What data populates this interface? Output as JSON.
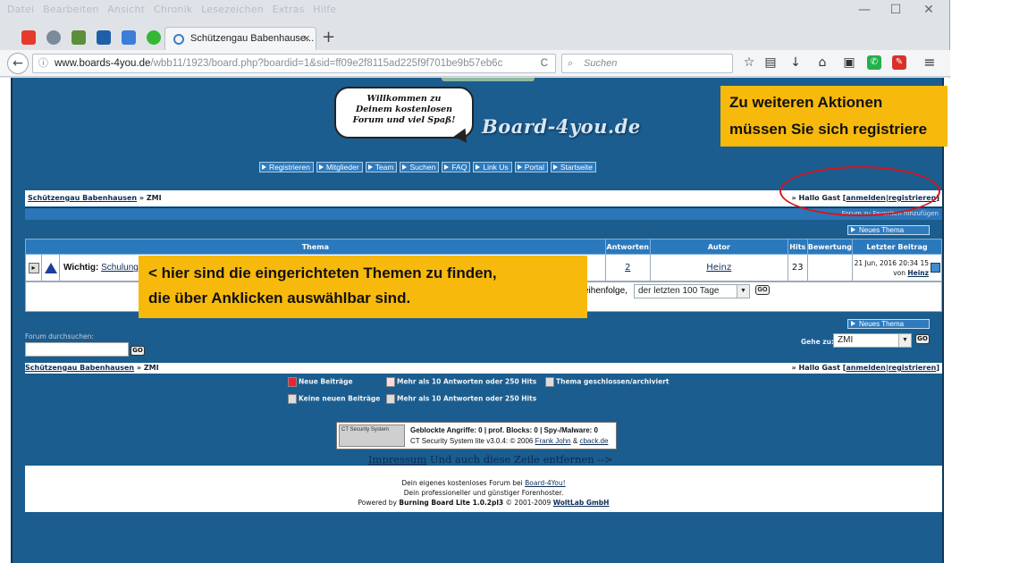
{
  "browser": {
    "menu": [
      "Datei",
      "Bearbeiten",
      "Ansicht",
      "Chronik",
      "Lesezeichen",
      "Extras",
      "Hilfe"
    ],
    "tab_title": "Schützengau Babenhause...",
    "url_host": "www.boards-4you.de",
    "url_path": "/wbb11/1923/board.php?boardid=1&sid=ff09e2f8115ad225f9f701be9b57eb6c",
    "search_placeholder": "Suchen",
    "window_controls": [
      "—",
      "☐",
      "✕"
    ]
  },
  "forum": {
    "bubble_text": [
      "Willkommen zu",
      "Deinem kostenlosen",
      "Forum und viel Spaß!"
    ],
    "logo": "Board-4you.de",
    "nav_buttons": [
      "Registrieren",
      "Mitglieder",
      "Team",
      "Suchen",
      "FAQ",
      "Link Us",
      "Portal",
      "Startseite"
    ],
    "breadcrumb": {
      "board": "Schützengau Babenhausen",
      "sep": " » ",
      "current": "ZMI"
    },
    "greeting": {
      "prefix": "» Hallo Gast [",
      "login": "anmelden",
      "sep": "|",
      "register": "registrieren",
      "suffix": "]"
    },
    "favorites": "Forum zu Favoriten hinzufügen",
    "new_topic": "Neues Thema",
    "table": {
      "headers": [
        "Thema",
        "Antworten",
        "Autor",
        "Hits",
        "Bewertung",
        "Letzter Beitrag"
      ],
      "rows": [
        {
          "prefix": "Wichtig:",
          "title": "Schulung",
          "replies": "2",
          "author": "Heinz",
          "hits": "23",
          "rating": "",
          "last_date": "21 Jun, 2016 20:34 15",
          "last_by_prefix": "von",
          "last_by": "Heinz"
        }
      ]
    },
    "sort": {
      "label": "eihenfolge,",
      "value": "der letzten 100 Tage",
      "go": "GO"
    },
    "search_label": "Forum durchsuchen:",
    "jump_label": "Gehe zu:",
    "jump_value": "ZMI",
    "legend": {
      "new_posts": "Neue Beiträge",
      "hot_new": "Mehr als 10 Antworten oder 250 Hits",
      "closed": "Thema geschlossen/archiviert",
      "no_new": "Keine neuen Beiträge",
      "hot_no_new": "Mehr als 10 Antworten oder 250 Hits"
    },
    "security": {
      "badge": "CT Security System",
      "line1": "Geblockte Angriffe: 0 | prof. Blocks: 0 | Spy-/Malware: 0",
      "line2_prefix": "CT Security System lite v3.0.4: © 2006",
      "author": "Frank John",
      "amp": "&",
      "site": "cback.de"
    },
    "impressum": {
      "link": "Impressum",
      "rest": " Und auch diese Zeile entfernen -->"
    },
    "footer": {
      "line1_prefix": "Dein eigenes kostenloses Forum bei",
      "line1_link": "Board-4You!",
      "line2": "Dein professioneller und günstiger Forenhoster.",
      "line3_prefix": "Powered by",
      "line3_product": "Burning Board Lite 1.0.2pl3",
      "line3_mid": "© 2001-2009",
      "line3_company": "WoltLab GmbH"
    }
  },
  "annotations": {
    "callout_top": [
      "Zu weiteren Aktionen",
      "müssen Sie sich registriere"
    ],
    "callout_table": [
      "< hier sind die eingerichteten Themen zu finden,",
      "die über Anklicken auswählbar sind."
    ],
    "colors": {
      "callout": "#f7b90c",
      "ring": "#d8141a",
      "forum_bg": "#1a5d8e"
    }
  }
}
